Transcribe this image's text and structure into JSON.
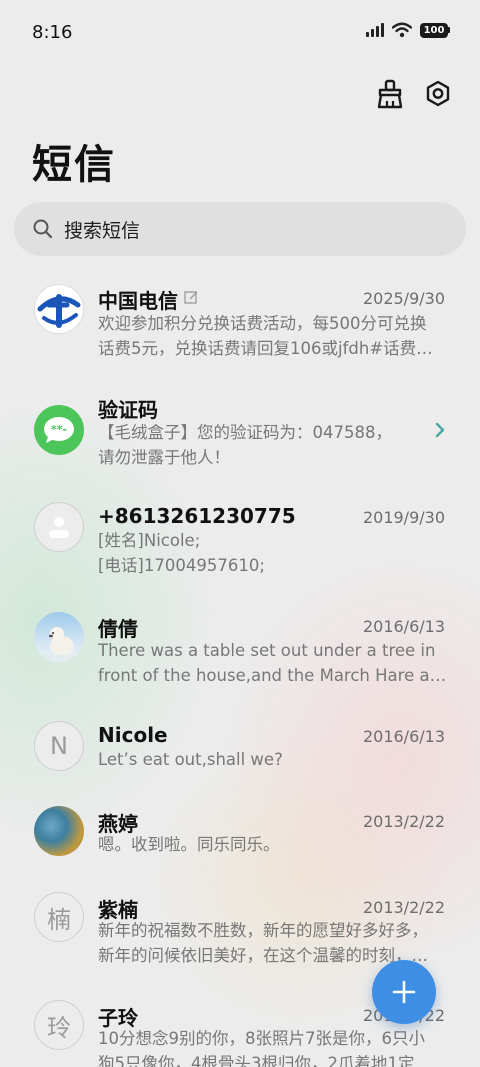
{
  "status_bar": {
    "time": "8:16",
    "battery": "100"
  },
  "header": {
    "title": "短信"
  },
  "search": {
    "placeholder": "搜索短信"
  },
  "conversations": [
    {
      "name": "中国电信",
      "date": "2025/9/30",
      "line1": "欢迎参加积分兑换话费活动，每500分可兑换",
      "line2": "话费5元，兑换话费请回复106或jfdh#话费…",
      "avatar": "china-telecom-logo",
      "tagged": true
    },
    {
      "name": "验证码",
      "date": "",
      "line1": "【毛绒盒子】您的验证码为：047588，",
      "line2": "请勿泄露于他人！",
      "avatar": "message-bubble-icon",
      "chevron": true
    },
    {
      "name": "+8613261230775",
      "date": "2019/9/30",
      "line1": "[姓名]Nicole;",
      "line2": "[电话]17004957610;",
      "avatar": "person-icon"
    },
    {
      "name": "倩倩",
      "date": "2016/6/13",
      "line1": "There was a table set out under a tree in",
      "line2": "front of the house,and the March Hare an…",
      "avatar": "polar-bear-photo"
    },
    {
      "name": "Nicole",
      "date": "2016/6/13",
      "line1": "Let’s eat out,shall we?",
      "line2": "",
      "avatar": "N"
    },
    {
      "name": "燕婷",
      "date": "2013/2/22",
      "line1": "嗯。收到啦。同乐同乐。",
      "line2": "",
      "avatar": "landscape-photo"
    },
    {
      "name": "紫楠",
      "date": "2013/2/22",
      "line1": "新年的祝福数不胜数，新年的愿望好多好多，",
      "line2": "新年的问候依旧美好，在这个温馨的时刻，…",
      "avatar": "楠"
    },
    {
      "name": "子玲",
      "date": "2013/2/22",
      "line1": "10分想念9别的你，8张照片7张是你，6只小",
      "line2": "狗5只像你，4根骨头3根归你，2爪着地1定",
      "avatar": "玲"
    }
  ],
  "colors": {
    "accent": "#3f8ee6",
    "green": "#4cc65a",
    "telecom_blue": "#1a55b7"
  }
}
